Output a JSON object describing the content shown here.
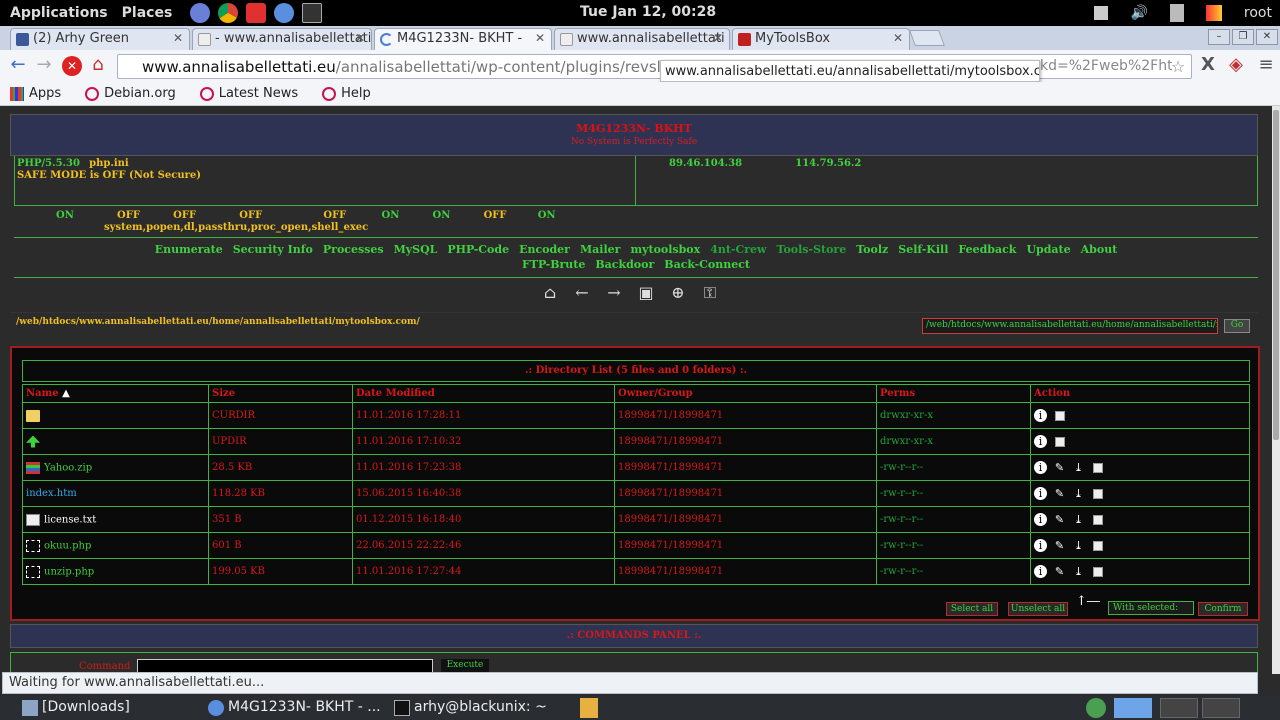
{
  "topbar": {
    "applications": "Applications",
    "places": "Places",
    "clock": "Tue Jan 12, 00:28",
    "user": "root"
  },
  "tabs": [
    {
      "label": "(2) Arhy Green",
      "color": "#3b5998"
    },
    {
      "label": "- www.annalisabellettati",
      "color": "#bbbbbb"
    },
    {
      "label": "M4G1233N- BKHT -",
      "color": "#4a7fd0"
    },
    {
      "label": "www.annalisabellettati",
      "color": "#bbbbbb"
    },
    {
      "label": "MyToolsBox",
      "color": "#c02020"
    }
  ],
  "address": {
    "host": "www.annalisabellettati.eu",
    "path": "/annalisabellettati/wp-content/plugins/revslider/tem",
    "tail": "kd=%2Fweb%2Fht"
  },
  "tooltip": "www.annalisabellettati.eu/annalisabellettati/mytoolsbox.com/u...",
  "bookmarks": [
    "Apps",
    "Debian.org",
    "Latest News",
    "Help"
  ],
  "page": {
    "title": "M4G1233N- BKHT",
    "subtitle": "No System is Perfectly Safe",
    "php_version": "PHP/5.5.30",
    "php_ini": "php.ini",
    "safe_mode": "SAFE MODE is OFF (Not Secure)",
    "server_ip": "89.46.104.38",
    "your_ip": "114.79.56.2",
    "toggles": [
      {
        "value": "ON"
      },
      {
        "value": "OFF"
      },
      {
        "value": "OFF"
      },
      {
        "value": "OFF"
      },
      {
        "value": "OFF"
      },
      {
        "value": "ON"
      },
      {
        "value": "ON"
      },
      {
        "value": "OFF"
      },
      {
        "value": "ON"
      }
    ],
    "disabled_funcs": "system,popen,dl,passthru,proc_open,shell_exec",
    "menu_row1": [
      "Enumerate",
      "Security Info",
      "Processes",
      "MySQL",
      "PHP-Code",
      "Encoder",
      "Mailer",
      "mytoolsbox",
      "4nt-Crew",
      "Tools-Store",
      "Toolz",
      "Self-Kill",
      "Feedback",
      "Update",
      "About"
    ],
    "menu_row2": [
      "FTP-Brute",
      "Backdoor",
      "Back-Connect"
    ],
    "path": "/web/htdocs/www.annalisabellettati.eu/home/annalisabellettati/mytoolsbox.com/",
    "dir_input": "/web/htdocs/www.annalisabellettati.eu/home/annalisabellettati/mytc",
    "go": "Go",
    "list_title": ".: Directory List (5 files and 0 folders) :.",
    "columns": [
      "Name",
      "Size",
      "Date Modified",
      "Owner/Group",
      "Perms",
      "Action"
    ],
    "rows": [
      {
        "name": "",
        "size": "CURDIR",
        "date": "11.01.2016 17:28:11",
        "owner": "18998471/18998471",
        "perms": "drwxr-xr-x",
        "icon": "folder"
      },
      {
        "name": "",
        "size": "UPDIR",
        "date": "11.01.2016 17:10:32",
        "owner": "18998471/18998471",
        "perms": "drwxr-xr-x",
        "icon": "up"
      },
      {
        "name": "Yahoo.zip",
        "size": "28.5 KB",
        "date": "11.01.2016 17:23:38",
        "owner": "18998471/18998471",
        "perms": "-rw-r--r--",
        "icon": "zip"
      },
      {
        "name": "index.htm",
        "size": "118.28 KB",
        "date": "15.06.2015 16:40:38",
        "owner": "18998471/18998471",
        "perms": "-rw-r--r--",
        "icon": "none"
      },
      {
        "name": "license.txt",
        "size": "351 B",
        "date": "01.12.2015 16:18:40",
        "owner": "18998471/18998471",
        "perms": "-rw-r--r--",
        "icon": "txt"
      },
      {
        "name": "okuu.php",
        "size": "601 B",
        "date": "22.06.2015 22:22:46",
        "owner": "18998471/18998471",
        "perms": "-rw-r--r--",
        "icon": "php"
      },
      {
        "name": "unzip.php",
        "size": "199.05 KB",
        "date": "11.01.2016 17:27:44",
        "owner": "18998471/18998471",
        "perms": "-rw-r--r--",
        "icon": "php"
      }
    ],
    "select_all": "Select all",
    "unselect_all": "Unselect all",
    "with_selected": "With selected:",
    "confirm": "Confirm",
    "commands_title": ".: COMMANDS PANEL :.",
    "command_label": "Command",
    "execute": "Execute"
  },
  "status": "Waiting for www.annalisabellettati.eu...",
  "taskbar": [
    "[Downloads]",
    "M4G1233N- BKHT - ...",
    "arhy@blackunix: ~"
  ]
}
